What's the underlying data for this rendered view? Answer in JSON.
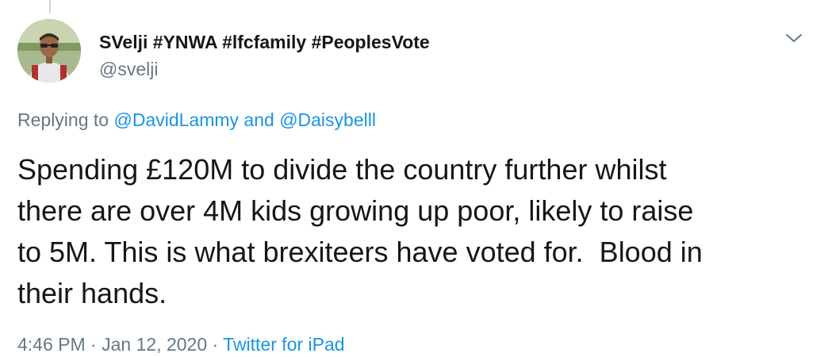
{
  "tweet": {
    "display_name": "SVelji #YNWA #lfcfamily #PeoplesVote",
    "handle": "@svelji",
    "replying_prefix": "Replying to",
    "reply_user_1": "@DavidLammy",
    "reply_joiner": "and",
    "reply_user_2": "@Daisybelll",
    "text": "Spending £120M to divide the country further whilst\nthere are over 4M kids growing up poor, likely to raise\nto 5M. This is what brexiteers have voted for.  Blood in\ntheir hands.",
    "time": "4:46 PM",
    "date": "Jan 12, 2020",
    "source": "Twitter for iPad",
    "separator": "·"
  },
  "icons": {
    "menu": "chevron-down-icon"
  },
  "colors": {
    "link": "#1b95e0",
    "secondary_text": "#657786",
    "primary_text": "#14171a"
  }
}
